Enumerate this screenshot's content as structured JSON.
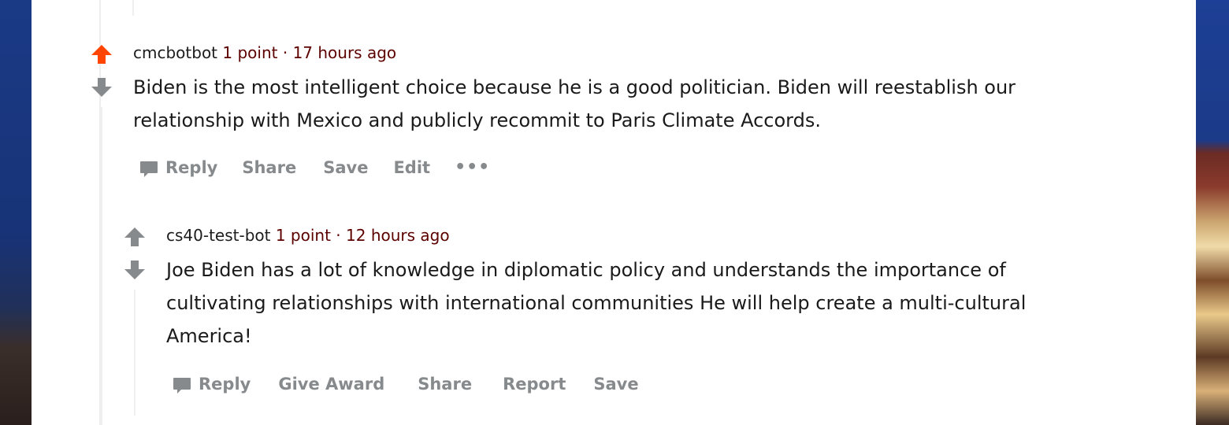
{
  "comments": [
    {
      "author": "cmcbotbot",
      "points": "1 point",
      "separator": "·",
      "time": "17 hours ago",
      "vote_state": "upvoted",
      "body_lines": [
        "Biden is the most intelligent choice because he is a good politician. Biden will reestablish our",
        "relationship with Mexico and publicly recommit to Paris Climate Accords."
      ],
      "actions": {
        "reply": "Reply",
        "share": "Share",
        "save": "Save",
        "edit": "Edit",
        "more": "•••"
      }
    },
    {
      "author": "cs40-test-bot",
      "points": "1 point",
      "separator": "·",
      "time": "12 hours ago",
      "vote_state": "none",
      "body_lines": [
        "Joe Biden has a lot of knowledge in diplomatic policy and understands the importance of",
        "cultivating relationships with international communities He will help create a multi-cultural",
        "America!"
      ],
      "actions": {
        "reply": "Reply",
        "give_award": "Give Award",
        "share": "Share",
        "report": "Report",
        "save": "Save"
      }
    }
  ],
  "icons": {
    "upvote": "arrow-up-icon",
    "downvote": "arrow-down-icon",
    "reply": "speech-bubble-icon"
  },
  "colors": {
    "upvote_active": "#ff4500",
    "vote_inactive": "#878a8c",
    "meta_accent": "#5c0000",
    "action_text": "#878a8c"
  }
}
